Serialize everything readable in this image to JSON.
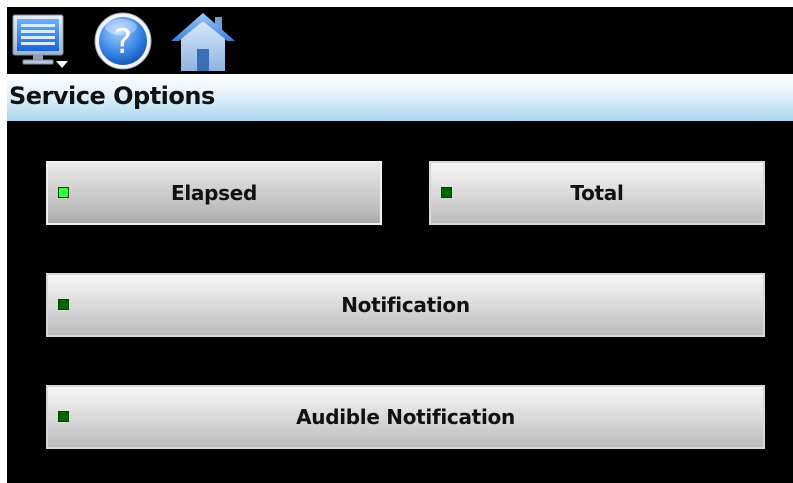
{
  "colors": {
    "screen_background": "#000000",
    "title_bar_gradient_top": "#ffffff",
    "title_bar_gradient_bottom": "#a8d6ef",
    "led_on": "#33ff33",
    "led_off": "#006600",
    "button_face": "#d6d6d6"
  },
  "toolbar": {
    "menu_icon": "monitor-menu-icon",
    "help_icon": "help-question-icon",
    "home_icon": "home-icon"
  },
  "header": {
    "title": "Service Options"
  },
  "options": [
    {
      "label": "Elapsed",
      "led_state": "on",
      "led_color": "#33ff33"
    },
    {
      "label": "Total",
      "led_state": "off",
      "led_color": "#006600"
    },
    {
      "label": "Notification",
      "led_state": "off",
      "led_color": "#006600"
    },
    {
      "label": "Audible Notification",
      "led_state": "off",
      "led_color": "#006600"
    }
  ]
}
